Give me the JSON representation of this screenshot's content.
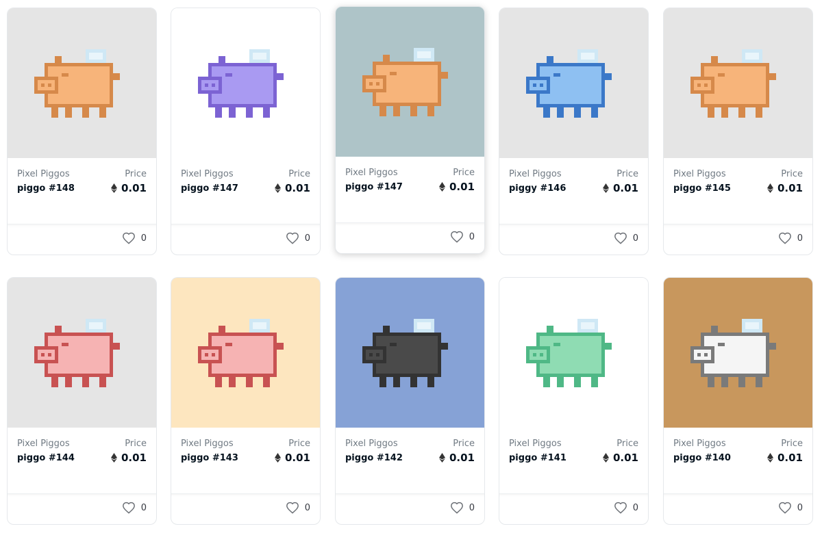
{
  "price_label": "Price",
  "cards": [
    {
      "collection": "Pixel Piggos",
      "name": "piggo #148",
      "price": "0.01",
      "likes": "0",
      "bg": "#e5e5e5",
      "pig_color": "#f7b47a",
      "pig_dark": "#d6894a"
    },
    {
      "collection": "Pixel Piggos",
      "name": "piggo #147",
      "price": "0.01",
      "likes": "0",
      "bg": "#ffffff",
      "pig_color": "#a99af2",
      "pig_dark": "#7c63d3"
    },
    {
      "collection": "Pixel Piggos",
      "name": "piggo #147",
      "price": "0.01",
      "likes": "0",
      "bg": "#aec4c8",
      "pig_color": "#f7b47a",
      "pig_dark": "#d6894a"
    },
    {
      "collection": "Pixel Piggos",
      "name": "piggy #146",
      "price": "0.01",
      "likes": "0",
      "bg": "#e5e5e5",
      "pig_color": "#8ec0f2",
      "pig_dark": "#3b78c8"
    },
    {
      "collection": "Pixel Piggos",
      "name": "piggo #145",
      "price": "0.01",
      "likes": "0",
      "bg": "#e5e5e5",
      "pig_color": "#f7b47a",
      "pig_dark": "#d6894a"
    },
    {
      "collection": "Pixel Piggos",
      "name": "piggo #144",
      "price": "0.01",
      "likes": "0",
      "bg": "#e5e5e5",
      "pig_color": "#f6b3b3",
      "pig_dark": "#c85252"
    },
    {
      "collection": "Pixel Piggos",
      "name": "piggo #143",
      "price": "0.01",
      "likes": "0",
      "bg": "#fde6bf",
      "pig_color": "#f6b3b3",
      "pig_dark": "#c85252"
    },
    {
      "collection": "Pixel Piggos",
      "name": "piggo #142",
      "price": "0.01",
      "likes": "0",
      "bg": "#86a2d6",
      "pig_color": "#4a4a4a",
      "pig_dark": "#333333"
    },
    {
      "collection": "Pixel Piggos",
      "name": "piggo #141",
      "price": "0.01",
      "likes": "0",
      "bg": "#ffffff",
      "pig_color": "#8fdcb3",
      "pig_dark": "#4fb886"
    },
    {
      "collection": "Pixel Piggos",
      "name": "piggo #140",
      "price": "0.01",
      "likes": "0",
      "bg": "#c8975d",
      "pig_color": "#f5f5f5",
      "pig_dark": "#7a7a7a"
    }
  ]
}
